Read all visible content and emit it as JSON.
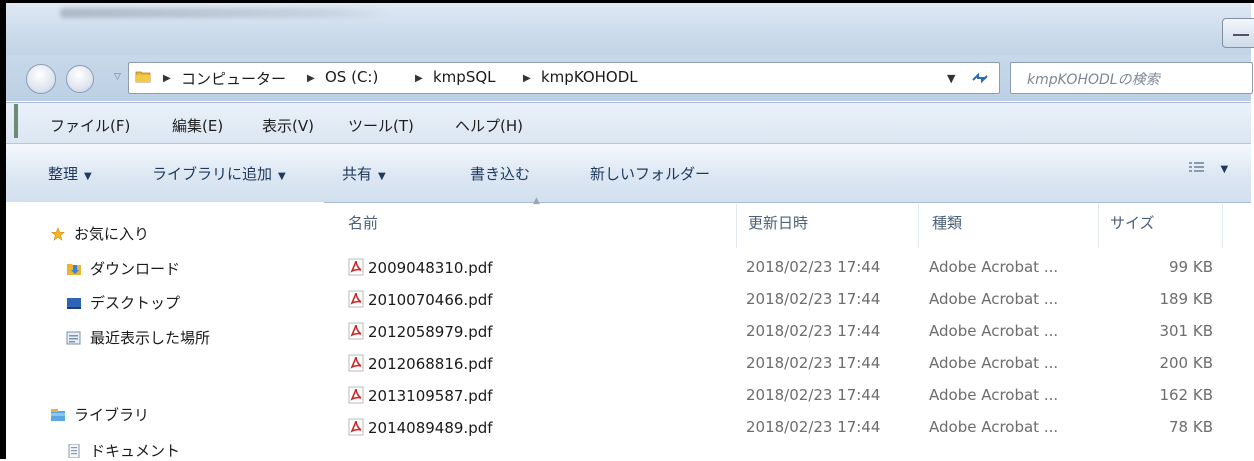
{
  "address": {
    "crumbs": [
      "コンピューター",
      "OS (C:)",
      "kmpSQL",
      "kmpKOHODL"
    ]
  },
  "search": {
    "placeholder": "kmpKOHODLの検索"
  },
  "menubar": [
    "ファイル(F)",
    "編集(E)",
    "表示(V)",
    "ツール(T)",
    "ヘルプ(H)"
  ],
  "commandbar": {
    "organize": "整理",
    "add_to_library": "ライブラリに追加",
    "share": "共有",
    "burn": "書き込む",
    "new_folder": "新しいフォルダー"
  },
  "navpane": {
    "favorites": "お気に入り",
    "favorites_items": [
      "ダウンロード",
      "デスクトップ",
      "最近表示した場所"
    ],
    "libraries": "ライブラリ",
    "libraries_items": [
      "ドキュメント"
    ]
  },
  "columns": {
    "name": "名前",
    "date": "更新日時",
    "type": "種類",
    "size": "サイズ"
  },
  "files": [
    {
      "name": "2009048310.pdf",
      "date": "2018/02/23 17:44",
      "type": "Adobe Acrobat ...",
      "size": "99 KB"
    },
    {
      "name": "2010070466.pdf",
      "date": "2018/02/23 17:44",
      "type": "Adobe Acrobat ...",
      "size": "189 KB"
    },
    {
      "name": "2012058979.pdf",
      "date": "2018/02/23 17:44",
      "type": "Adobe Acrobat ...",
      "size": "301 KB"
    },
    {
      "name": "2012068816.pdf",
      "date": "2018/02/23 17:44",
      "type": "Adobe Acrobat ...",
      "size": "200 KB"
    },
    {
      "name": "2013109587.pdf",
      "date": "2018/02/23 17:44",
      "type": "Adobe Acrobat ...",
      "size": "162 KB"
    },
    {
      "name": "2014089489.pdf",
      "date": "2018/02/23 17:44",
      "type": "Adobe Acrobat ...",
      "size": "78 KB"
    }
  ],
  "colors": {
    "accent": "#1e395b",
    "pdf_red": "#c8282e",
    "folder_yellow": "#e8b632"
  }
}
